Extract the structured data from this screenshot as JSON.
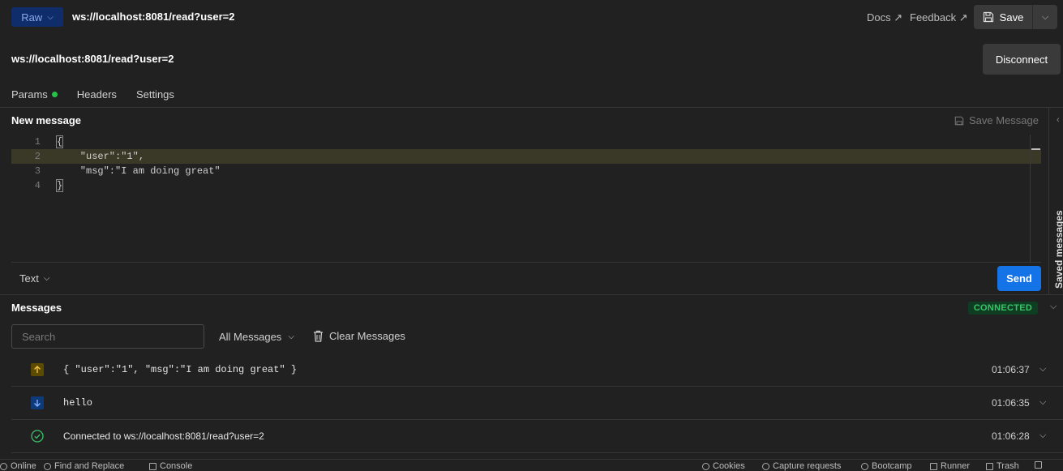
{
  "topbar": {
    "mode_label": "Raw",
    "url": "ws://localhost:8081/read?user=2",
    "docs_label": "Docs ↗",
    "feedback_label": "Feedback ↗",
    "save_label": "Save"
  },
  "connection": {
    "url": "ws://localhost:8081/read?user=2",
    "disconnect_label": "Disconnect"
  },
  "tabs": [
    {
      "label": "Params",
      "has_dot": true
    },
    {
      "label": "Headers"
    },
    {
      "label": "Settings"
    }
  ],
  "new_message": {
    "title": "New message",
    "save_message_label": "Save Message",
    "code_lines": [
      {
        "num": "1",
        "text": "{"
      },
      {
        "num": "2",
        "text": "    \"user\":\"1\","
      },
      {
        "num": "3",
        "text": "    \"msg\":\"I am doing great\""
      },
      {
        "num": "4",
        "text": "}"
      }
    ],
    "format_label": "Text",
    "send_label": "Send",
    "saved_messages_label": "Saved messages"
  },
  "messages": {
    "title": "Messages",
    "status": "CONNECTED",
    "search_placeholder": "Search",
    "filter_label": "All Messages",
    "clear_label": "Clear Messages",
    "items": [
      {
        "type": "sent",
        "text": "{ \"user\":\"1\", \"msg\":\"I am doing great\" }",
        "time": "01:06:37"
      },
      {
        "type": "received",
        "text": "hello",
        "time": "01:06:35"
      },
      {
        "type": "connected",
        "text": "Connected to ws://localhost:8081/read?user=2",
        "time": "01:06:28"
      }
    ]
  },
  "statusbar": {
    "online": "Online",
    "find_replace": "Find and Replace",
    "console": "Console",
    "cookies": "Cookies",
    "capture": "Capture requests",
    "bootcamp": "Bootcamp",
    "runner": "Runner",
    "trash": "Trash"
  },
  "colors": {
    "background": "#212121",
    "accent_blue": "#1473e6",
    "connected_green": "#39c46a",
    "sent_icon_bg": "#5c4a00",
    "received_icon_bg": "#0f3a7a"
  }
}
